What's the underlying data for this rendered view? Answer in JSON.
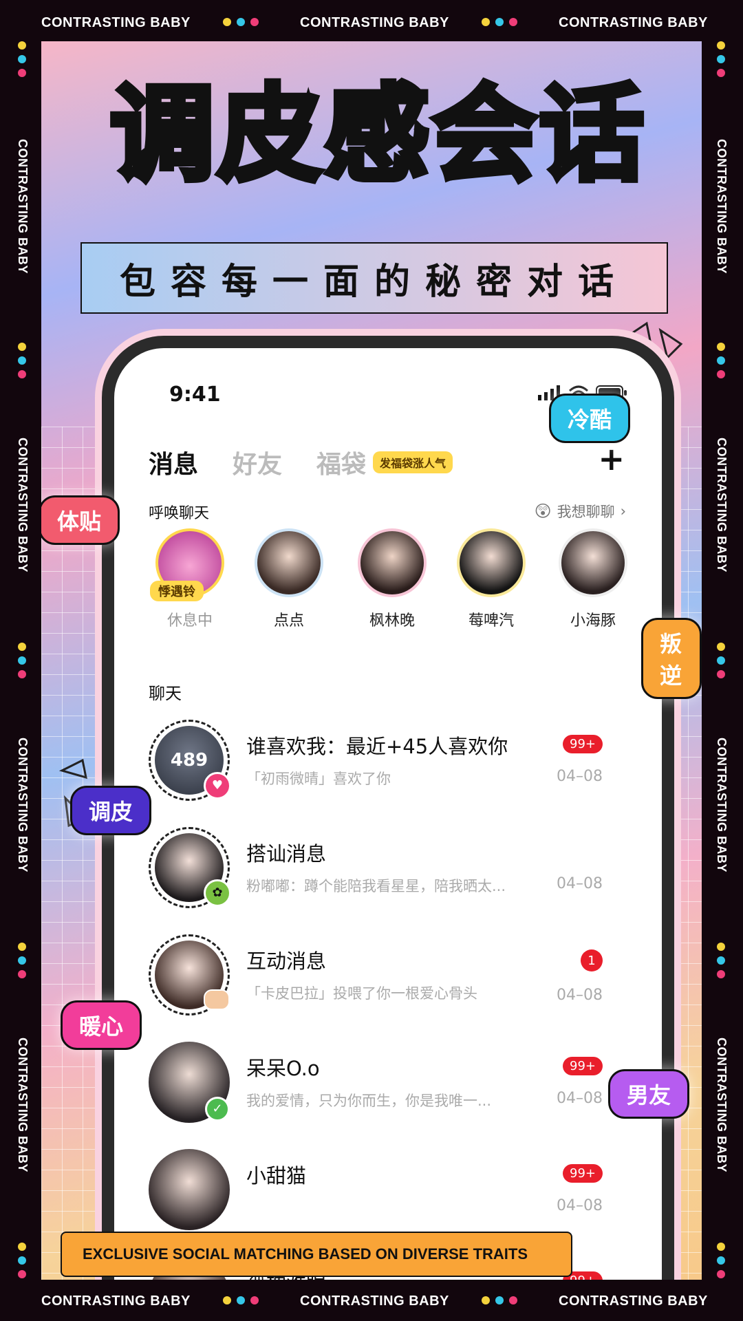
{
  "frame": {
    "banner_text": "CONTRASTING BABY",
    "dot_colors": [
      "#f4d23c",
      "#35c7e8",
      "#ef3d78"
    ]
  },
  "headline": "调皮感会话",
  "subheadline": "包容每一面的秘密对话",
  "phone": {
    "status_time": "9:41",
    "tabs": [
      {
        "label": "消息"
      },
      {
        "label": "好友"
      },
      {
        "label": "福袋"
      }
    ],
    "promo_label": "发福袋涨人气",
    "plus_label": "+",
    "summon_label": "呼唤聊天",
    "summon_action": "我想聊聊",
    "stories": [
      {
        "name": "休息中",
        "badge": "悸遇铃"
      },
      {
        "name": "点点"
      },
      {
        "name": "枫林晚"
      },
      {
        "name": "莓啤汽"
      },
      {
        "name": "小海豚"
      }
    ],
    "chat_section_label": "聊天",
    "chats": [
      {
        "avatar_text": "489",
        "name": "谁喜欢我：最近+45人喜欢你",
        "preview": "「初雨微晴」喜欢了你",
        "time": "04–08",
        "badge": "99+"
      },
      {
        "name": "搭讪消息",
        "preview": "粉嘟嘟：蹲个能陪我看星星，陪我晒太...",
        "time": "04–08"
      },
      {
        "name": "互动消息",
        "preview": "「卡皮巴拉」投喂了你一根爱心骨头",
        "time": "04–08",
        "badge": "1"
      },
      {
        "name": "呆呆O.o",
        "preview": "我的爱情，只为你而生，你是我唯一...",
        "time": "04–08",
        "badge": "99+"
      },
      {
        "name": "小甜猫",
        "preview": "",
        "time": "04–08",
        "badge": "99+"
      },
      {
        "name": "孤枕难眠",
        "preview": "",
        "time": "",
        "badge": "99+"
      }
    ]
  },
  "tags": {
    "t1": "冷酷",
    "t2": "体贴",
    "t3": "叛逆",
    "t4": "调皮",
    "t5": "暖心",
    "t6": "男友"
  },
  "bottom_banner": "EXCLUSIVE SOCIAL MATCHING BASED ON DIVERSE TRAITS"
}
